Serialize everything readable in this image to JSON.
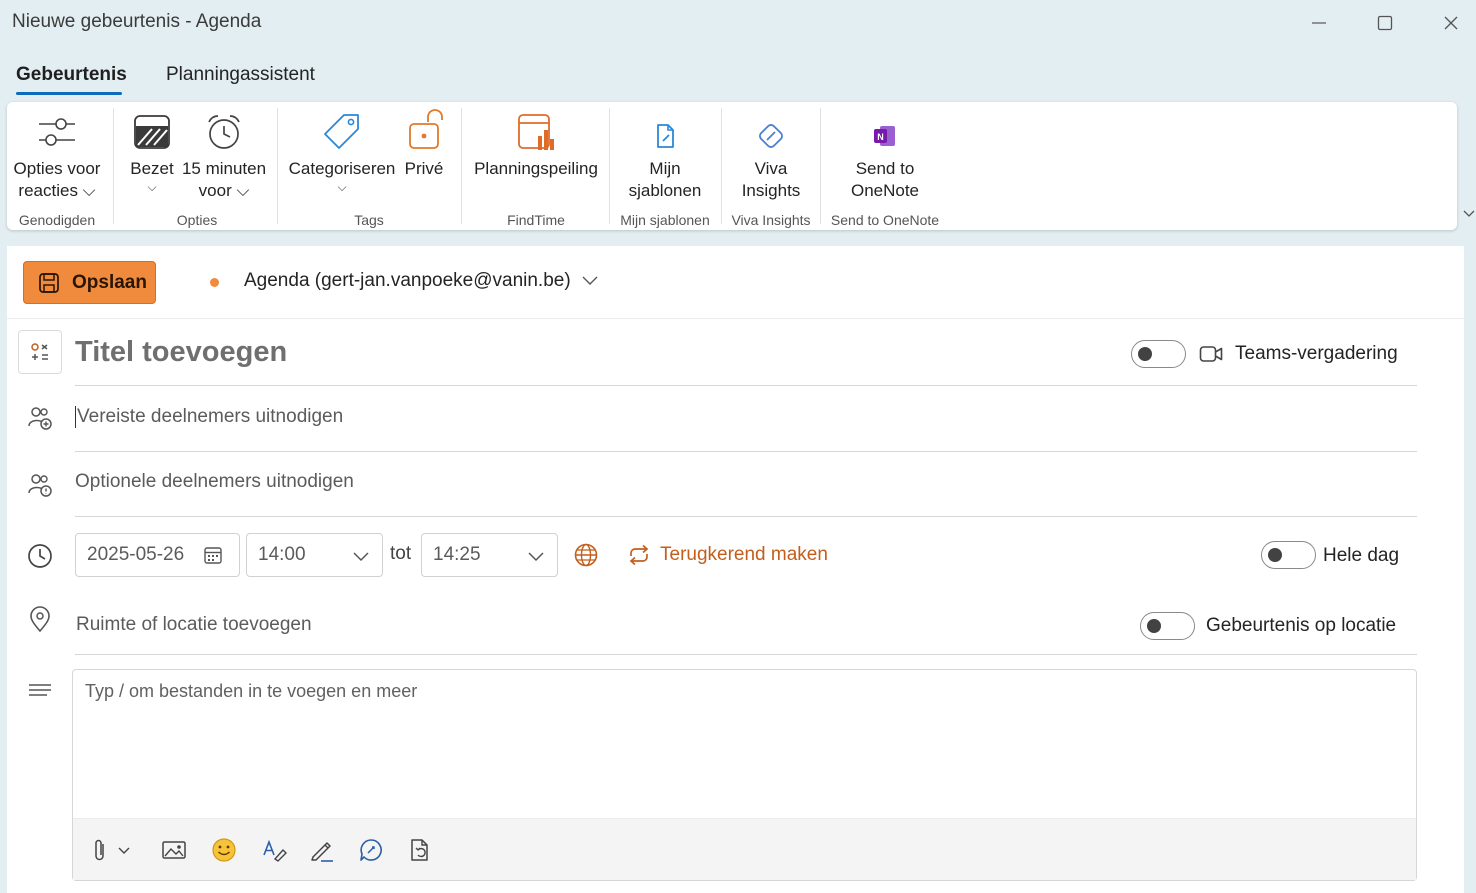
{
  "window": {
    "title": "Nieuwe gebeurtenis - Agenda",
    "controls": [
      "minimize-icon",
      "maximize-icon",
      "close-icon"
    ]
  },
  "tabs": [
    {
      "label": "Gebeurtenis",
      "active": true
    },
    {
      "label": "Planningassistent",
      "active": false
    }
  ],
  "ribbon": {
    "groups": [
      {
        "label": "Genodigden",
        "buttons": [
          {
            "line1": "Opties voor",
            "line2": "reacties ⌵",
            "icon": "response-options-icon"
          }
        ]
      },
      {
        "label": "Opties",
        "buttons": [
          {
            "line1": "Bezet",
            "line2": "",
            "icon": "busy-status-icon"
          },
          {
            "line1": "15 minuten",
            "line2": "voor ⌵",
            "icon": "reminder-alarm-icon"
          }
        ]
      },
      {
        "label": "Tags",
        "buttons": [
          {
            "line1": "Categoriseren",
            "line2": "",
            "icon": "tag-icon"
          },
          {
            "line1": "Privé",
            "line2": "",
            "icon": "lock-icon"
          }
        ]
      },
      {
        "label": "FindTime",
        "buttons": [
          {
            "line1": "Planningspeiling",
            "line2": "",
            "icon": "findtime-poll-icon"
          }
        ]
      },
      {
        "label": "Mijn sjablonen",
        "buttons": [
          {
            "line1": "Mijn",
            "line2": "sjablonen",
            "icon": "templates-icon"
          }
        ]
      },
      {
        "label": "Viva Insights",
        "buttons": [
          {
            "line1": "Viva",
            "line2": "Insights",
            "icon": "viva-insights-icon"
          }
        ]
      },
      {
        "label": "Send to OneNote",
        "buttons": [
          {
            "line1": "Send to",
            "line2": "OneNote",
            "icon": "onenote-icon"
          }
        ]
      }
    ]
  },
  "event": {
    "save_label": "Opslaan",
    "calendar": "Agenda (gert-jan.vanpoeke@vanin.be)",
    "title_placeholder": "Titel toevoegen",
    "teams_label": "Teams-vergadering",
    "teams_on": false,
    "required_placeholder": "Vereiste deelnemers uitnodigen",
    "optional_placeholder": "Optionele deelnemers uitnodigen",
    "date": "2025-05-26",
    "start_time": "14:00",
    "to_label": "tot",
    "end_time": "14:25",
    "recurring_label": "Terugkerend maken",
    "all_day_label": "Hele dag",
    "all_day_on": false,
    "location_placeholder": "Ruimte of locatie toevoegen",
    "in_person_label": "Gebeurtenis op locatie",
    "in_person_on": false,
    "body_placeholder": "Typ / om bestanden in te voegen en meer"
  },
  "body_toolbar": [
    "paperclip-icon",
    "image-icon",
    "emoji-icon",
    "format-text-icon",
    "pen-icon",
    "chat-loop-icon",
    "document-sync-icon"
  ],
  "colors": {
    "accent_orange": "#f08a3c",
    "tab_underline": "#0f6cbd",
    "recurring_text": "#c35e1c"
  }
}
